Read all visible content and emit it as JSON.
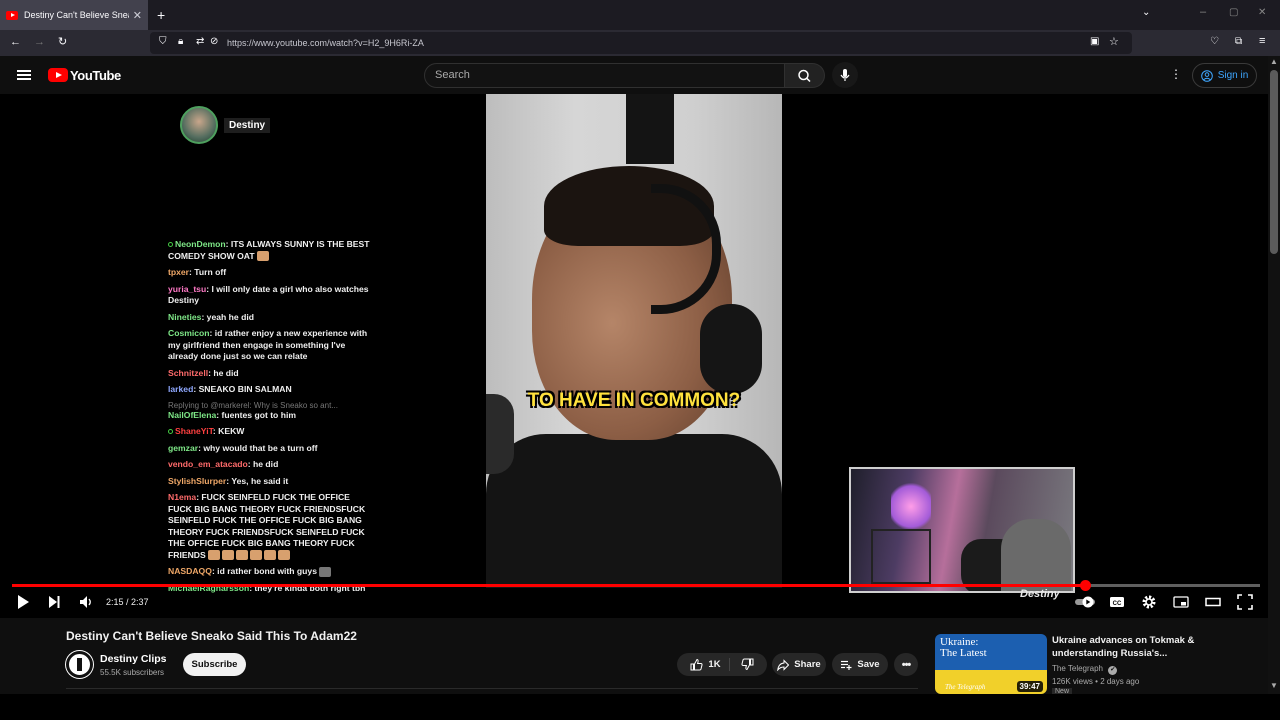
{
  "browser": {
    "tab_title": "Destiny Can't Believe Sneako Sa",
    "tab_close": "✕",
    "new_tab": "+",
    "url": "https://www.youtube.com/watch?v=H2_9H6Ri-ZA"
  },
  "youtube": {
    "logo_text": "YouTube",
    "search_placeholder": "Search",
    "signin_label": "Sign in"
  },
  "video": {
    "streamer_name": "Destiny",
    "caption": "TO HAVE IN COMMON?",
    "watermark": "Destiny",
    "time_display": "2:15 / 2:37",
    "progress": 0.86,
    "chat": [
      {
        "user": "NeonDemon",
        "color": "#7ee787",
        "text": ": ITS ALWAYS SUNNY IS THE BEST COMEDY SHOW OAT",
        "badge": true,
        "emote": true
      },
      {
        "user": "tpxer",
        "color": "#f0a868",
        "text": ": Turn off"
      },
      {
        "user": "yuria_tsu",
        "color": "#ff79c6",
        "text": ": I will only date a girl who also watches Destiny"
      },
      {
        "user": "Nineties",
        "color": "#7ee787",
        "text": ": yeah he did"
      },
      {
        "user": "Cosmicon",
        "color": "#7ee787",
        "text": ": id rather enjoy a new experience with my girlfriend then engage in something I've already done just so we can relate"
      },
      {
        "user": "Schnitzell",
        "color": "#ff6b6b",
        "text": ": he did"
      },
      {
        "user": "larked",
        "color": "#8fa8ff",
        "text": ": SNEAKO BIN SALMAN"
      },
      {
        "reply": "Replying to @markerel: Why is Sneako so ant..."
      },
      {
        "user": "NailOfElena",
        "color": "#7ee787",
        "text": ": fuentes got to him"
      },
      {
        "user": "ShaneYiT",
        "color": "#ff4040",
        "text": ": KEKW",
        "badge": true
      },
      {
        "user": "gemzar",
        "color": "#7ee787",
        "text": ": why would that be a turn off"
      },
      {
        "user": "vendo_em_atacado",
        "color": "#ff6b6b",
        "text": ": he did"
      },
      {
        "user": "StylishSlurper",
        "color": "#f0a868",
        "text": ": Yes, he said it"
      },
      {
        "user": "N1ema",
        "color": "#ff6b6b",
        "text": ": FUCK SEINFELD FUCK THE OFFICE FUCK BIG BANG THEORY FUCK FRIENDSFUCK SEINFELD FUCK THE OFFICE FUCK BIG BANG THEORY FUCK FRIENDSFUCK SEINFELD FUCK THE OFFICE FUCK BIG BANG THEORY FUCK FRIENDS",
        "emotes": 6
      },
      {
        "user": "NASDAQQ",
        "color": "#f0a868",
        "text": ": id rather bond with guys",
        "emote_gray": true
      },
      {
        "user": "MichaelRagnarsson",
        "color": "#7ee787",
        "text": ": they're kinda both right tbh"
      }
    ]
  },
  "meta": {
    "title": "Destiny Can't Believe Sneako Said This To Adam22",
    "channel_name": "Destiny Clips",
    "subscribers": "55.5K subscribers",
    "subscribe_label": "Subscribe",
    "like_count": "1K",
    "share_label": "Share",
    "save_label": "Save"
  },
  "recommendation": {
    "thumb_title": "Ukraine:\nThe Latest",
    "thumb_brand": "The Telegraph",
    "duration": "39:47",
    "title": "Ukraine advances on Tokmak & understanding Russia's...",
    "channel": "The Telegraph",
    "verified": "✔",
    "views": "126K views",
    "age": "2 days ago",
    "badge": "New"
  },
  "colors": {
    "accent_red": "#ff0000",
    "signin_blue": "#3ea6ff",
    "caption_yellow": "#ffe23d"
  }
}
